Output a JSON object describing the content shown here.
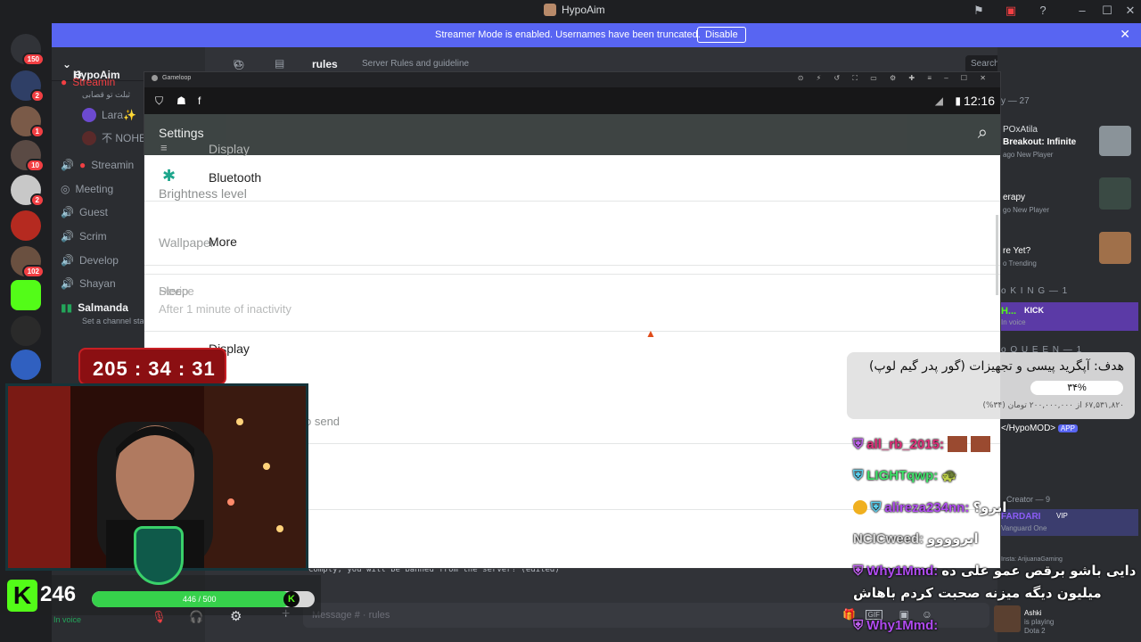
{
  "window": {
    "title": "HypoAim"
  },
  "streamer_banner": {
    "message": "Streamer Mode is enabled. Usernames have been truncated.",
    "button": "Disable"
  },
  "guild_badges": [
    "150",
    "2",
    "1",
    "10",
    "2",
    "102"
  ],
  "server": {
    "name": "HypoAim",
    "channel": "rules",
    "topic": "Server Rules and guideline",
    "search_placeholder": "Search HypoAim"
  },
  "channels": [
    {
      "label": "Streamin",
      "kind": "voice"
    },
    {
      "label": "Lara✨",
      "kind": "user"
    },
    {
      "label": "不 NOHE",
      "kind": "user"
    },
    {
      "label": "Streamin",
      "kind": "voice"
    },
    {
      "label": "Meeting",
      "kind": "voice"
    },
    {
      "label": "Guest",
      "kind": "voice"
    },
    {
      "label": "Scrim",
      "kind": "voice"
    },
    {
      "label": "Develop",
      "kind": "voice"
    },
    {
      "label": "Shayan",
      "kind": "voice"
    },
    {
      "label": "Salmanda",
      "kind": "voice"
    },
    {
      "label": "Set a channel sta",
      "kind": "status"
    }
  ],
  "channel_sub": "ثبلت تو قصابی",
  "user_panel": {
    "status": "In voice"
  },
  "gameloop": {
    "brand": "Gameloop",
    "clock": "12:16",
    "settings_title": "Settings",
    "items": [
      "Display",
      "Bluetooth",
      "Brightness level",
      "Wallpaper",
      "More",
      "Sleep",
      "Device",
      "After 1 minute of inactivity",
      "Display",
      "o send"
    ]
  },
  "members": {
    "header": "y — 27",
    "activities": [
      {
        "name": "POxAtila",
        "detail": "Breakout: Infinite",
        "sub": "ago  New Player"
      },
      {
        "name": "erapy",
        "detail": "",
        "sub": "go  New Player"
      },
      {
        "name": "re Yet?",
        "detail": "",
        "sub": "o  Trending"
      }
    ],
    "groups": [
      "o K I N G — 1",
      "o Q U E E N — 1",
      "Creator — 9"
    ],
    "kick_live": "KICK",
    "in_voice": "In voice",
    "hypomod": "</HypoMOD>",
    "app_tag": "APP",
    "vip_name": "FARDARI",
    "vip_tag": "VIP",
    "vanguard": "Vanguard One",
    "insta": "Insta: ArijuanaGaming",
    "ashki": {
      "name": "Ashki",
      "status": "is playing",
      "game": "Dota 2"
    }
  },
  "message_input": {
    "placeholder": "Message # · rules"
  },
  "bg_message": "Comply, you will be banned from the server! (edited)",
  "timer": "205 : 34 : 31",
  "kick_overlay": {
    "viewers": "246",
    "progress_text": "446 / 500",
    "progress": 0.892
  },
  "goal": {
    "title": "هدف: آپگرید پیسی و تجهیزات (گور پدر گیم لوپ)",
    "percent": "۳۴%",
    "amount": "۶۷,۵۳۱,۸۲۰ از ۲۰۰,۰۰۰,۰۰۰ تومان (۳۴%)"
  },
  "chat": [
    {
      "user": "all_rb_2015:",
      "text": "",
      "color": "#e0307a"
    },
    {
      "user": "LIGHTqwp:",
      "text": "",
      "color": "#3fe36a"
    },
    {
      "user": "alireza234nn:",
      "text": "ابرو؟",
      "color": "#b04bf0"
    },
    {
      "user": "NCICweed:",
      "text": "ابروووو",
      "color": "#dcdcdc"
    },
    {
      "user": "Why1Mmd:",
      "text": "دایی باشو برقص عمو علی ده",
      "color": "#b04bf0"
    },
    {
      "user": "",
      "text": "میلیون دیگه میزنه صحبت کردم باهاش",
      "color": "#ffffff"
    },
    {
      "user": "Why1Mmd:",
      "text": "",
      "color": "#b04bf0"
    }
  ]
}
